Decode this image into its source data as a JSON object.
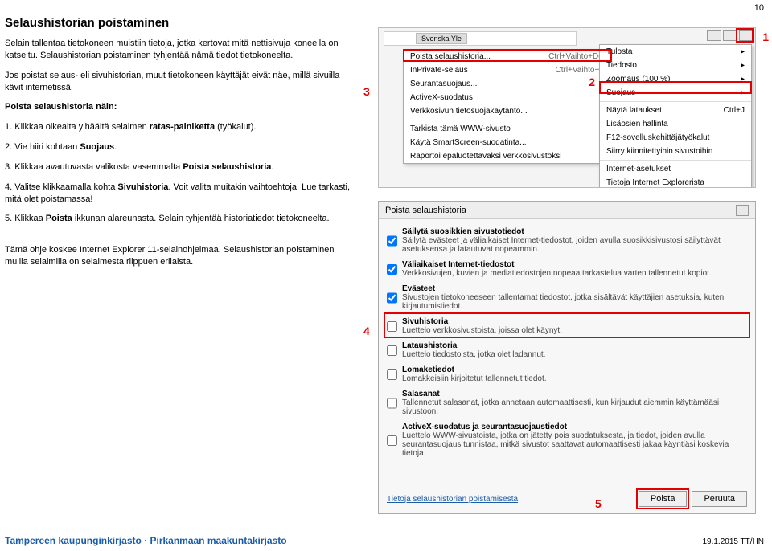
{
  "page_number_top": "10",
  "doc": {
    "title": "Selaushistorian poistaminen",
    "intro1": "Selain tallentaa tietokoneen muistiin tietoja, jotka kertovat mitä nettisivuja koneella on katseltu. Selaushistorian poistaminen tyhjentää nämä tiedot tietokoneelta.",
    "intro2": "Jos poistat selaus- eli sivuhistorian, muut tietokoneen käyttäjät eivät näe, millä sivuilla kävit internetissä.",
    "subhead": "Poista selaushistoria näin:",
    "step1a": "1. Klikkaa oikealta ylhäältä selaimen ",
    "step1b": "ratas-painiketta",
    "step1c": " (työkalut).",
    "step2a": "2. Vie hiiri kohtaan ",
    "step2b": "Suojaus",
    "step2c": ".",
    "step3a": "3. Klikkaa avautuvasta valikosta vasemmalta ",
    "step3b": "Poista selaushistoria",
    "step3c": ".",
    "step4a": "4. Valitse klikkaamalla kohta ",
    "step4b": "Sivuhistoria",
    "step4c": ". Voit valita muitakin vaihtoehtoja. Lue tarkasti, mitä olet poistamassa!",
    "step5a": "5. Klikkaa ",
    "step5b": "Poista",
    "step5c": " ikkunan alareunasta. Selain tyhjentää historiatiedot tietokoneelta.",
    "note": "Tämä ohje koskee Internet Explorer 11-selainohjelmaa. Selaushistorian poistaminen muilla selaimilla on selaimesta riippuen erilaista."
  },
  "callouts": {
    "c1": "1",
    "c2": "2",
    "c3": "3",
    "c4": "4",
    "c5": "5"
  },
  "ctxMenu": {
    "tab": "Svenska Yle",
    "i1": {
      "l": "Poista selaushistoria...",
      "s": "Ctrl+Vaihto+Del"
    },
    "i2": {
      "l": "InPrivate-selaus",
      "s": "Ctrl+Vaihto+P"
    },
    "i3": {
      "l": "Seurantasuojaus..."
    },
    "i4": {
      "l": "ActiveX-suodatus"
    },
    "i5": {
      "l": "Verkkosivun tietosuojakäytäntö..."
    },
    "i6": {
      "l": "Tarkista tämä WWW-sivusto"
    },
    "i7": {
      "l": "Käytä SmartScreen-suodatinta..."
    },
    "i8": {
      "l": "Raportoi epäluotettavaksi verkkosivustoksi"
    }
  },
  "toolsMenu": {
    "i1": "Tulosta",
    "i2": "Tiedosto",
    "i3": "Zoomaus (100 %)",
    "i4": "Suojaus",
    "i5": {
      "l": "Näytä lataukset",
      "s": "Ctrl+J"
    },
    "i6": "Lisäosien hallinta",
    "i7": "F12-sovelluskehittäjätyökalut",
    "i8": "Siirry kiinnitettyihin sivustoihin",
    "i9": "Internet-asetukset",
    "i10": "Tietoja Internet Explorerista"
  },
  "dialog": {
    "title": "Poista selaushistoria",
    "o1": {
      "t": "Säilytä suosikkien sivustotiedot",
      "d": "Säilytä evästeet ja väliaikaiset Internet-tiedostot, joiden avulla suosikkisivustosi säilyttävät asetuksensa ja latautuvat nopeammin.",
      "c": true
    },
    "o2": {
      "t": "Väliaikaiset Internet-tiedostot",
      "d": "Verkkosivujen, kuvien ja mediatiedostojen nopeaa tarkastelua varten tallennetut kopiot.",
      "c": true
    },
    "o3": {
      "t": "Evästeet",
      "d": "Sivustojen tietokoneeseen tallentamat tiedostot, jotka sisältävät käyttäjien asetuksia, kuten kirjautumistiedot.",
      "c": true
    },
    "o4": {
      "t": "Sivuhistoria",
      "d": "Luettelo verkkosivustoista, joissa olet käynyt.",
      "c": false
    },
    "o5": {
      "t": "Lataushistoria",
      "d": "Luettelo tiedostoista, jotka olet ladannut.",
      "c": false
    },
    "o6": {
      "t": "Lomaketiedot",
      "d": "Lomakkeisiin kirjoitetut tallennetut tiedot.",
      "c": false
    },
    "o7": {
      "t": "Salasanat",
      "d": "Tallennetut salasanat, jotka annetaan automaattisesti, kun kirjaudut aiemmin käyttämääsi sivustoon.",
      "c": false
    },
    "o8": {
      "t": "ActiveX-suodatus ja seurantasuojaustiedot",
      "d": "Luettelo WWW-sivustoista, jotka on jätetty pois suodatuksesta, ja tiedot, joiden avulla seurantasuojaus tunnistaa, mitkä sivustot saattavat automaattisesti jakaa käyntiäsi koskevia tietoja.",
      "c": false
    },
    "link": "Tietoja selaushistorian poistamisesta",
    "btn_delete": "Poista",
    "btn_cancel": "Peruuta"
  },
  "footer": {
    "logo": "Tampereen kaupunginkirjasto · Pirkanmaan maakuntakirjasto",
    "date": "19.1.2015 TT/HN"
  }
}
